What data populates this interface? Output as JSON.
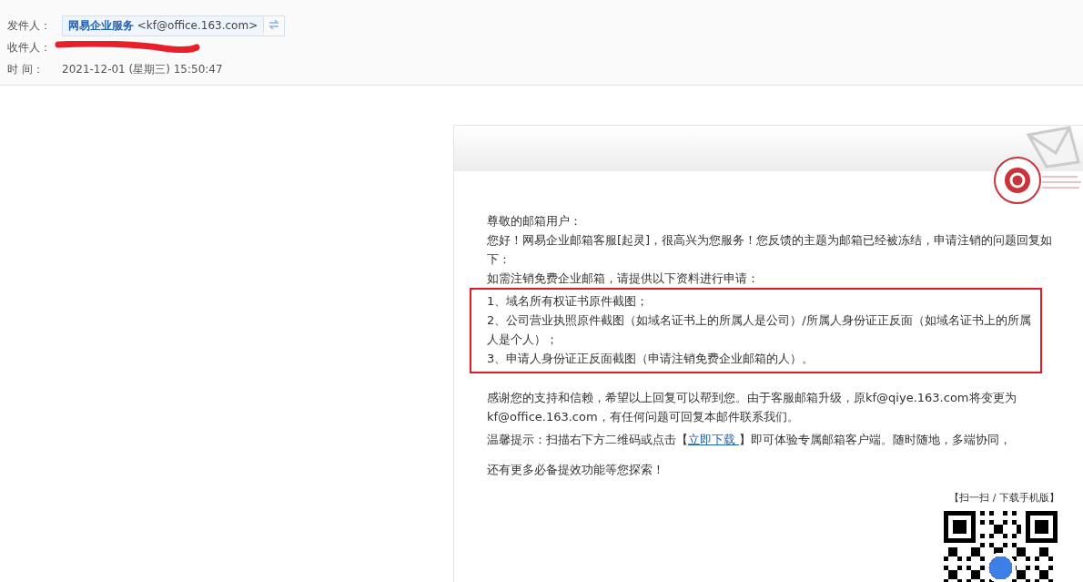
{
  "header": {
    "fields": [
      {
        "label": "发件人：",
        "kind": "sender",
        "name": "网易企业服务",
        "address": "<kf@office.163.com>"
      },
      {
        "label": "收件人：",
        "kind": "redacted"
      },
      {
        "label": "时 间：",
        "kind": "text",
        "value": "2021-12-01 (星期三) 15:50:47"
      }
    ]
  },
  "message": {
    "greeting": "尊敬的邮箱用户：",
    "intro": "您好！网易企业邮箱客服[起灵]，很高兴为您服务！您反馈的主题为邮箱已经被冻结，申请注销的问题回复如下：",
    "request": "如需注销免费企业邮箱，请提供以下资料进行申请：",
    "items": [
      "1、域名所有权证书原件截图；",
      "2、公司营业执照原件截图（如域名证书上的所属人是公司）/所属人身份证正反面（如域名证书上的所属人是个人）；",
      "3、申请人身份证正反面截图（申请注销免费企业邮箱的人）。"
    ],
    "thanks": "感谢您的支持和信赖，希望以上回复可以帮到您。由于客服邮箱升级，原kf@qiye.163.com将变更为kf@office.163.com，有任何问题可回复本邮件联系我们。",
    "tip_before": "温馨提示：扫描右下方二维码或点击【",
    "tip_link": "立即下载 ",
    "tip_after": "】即可体验专属邮箱客户端。随时随地，多端协同，",
    "closing": "还有更多必备提效功能等您探索！",
    "qr_caption": "【扫一扫 / 下载手机版】"
  }
}
